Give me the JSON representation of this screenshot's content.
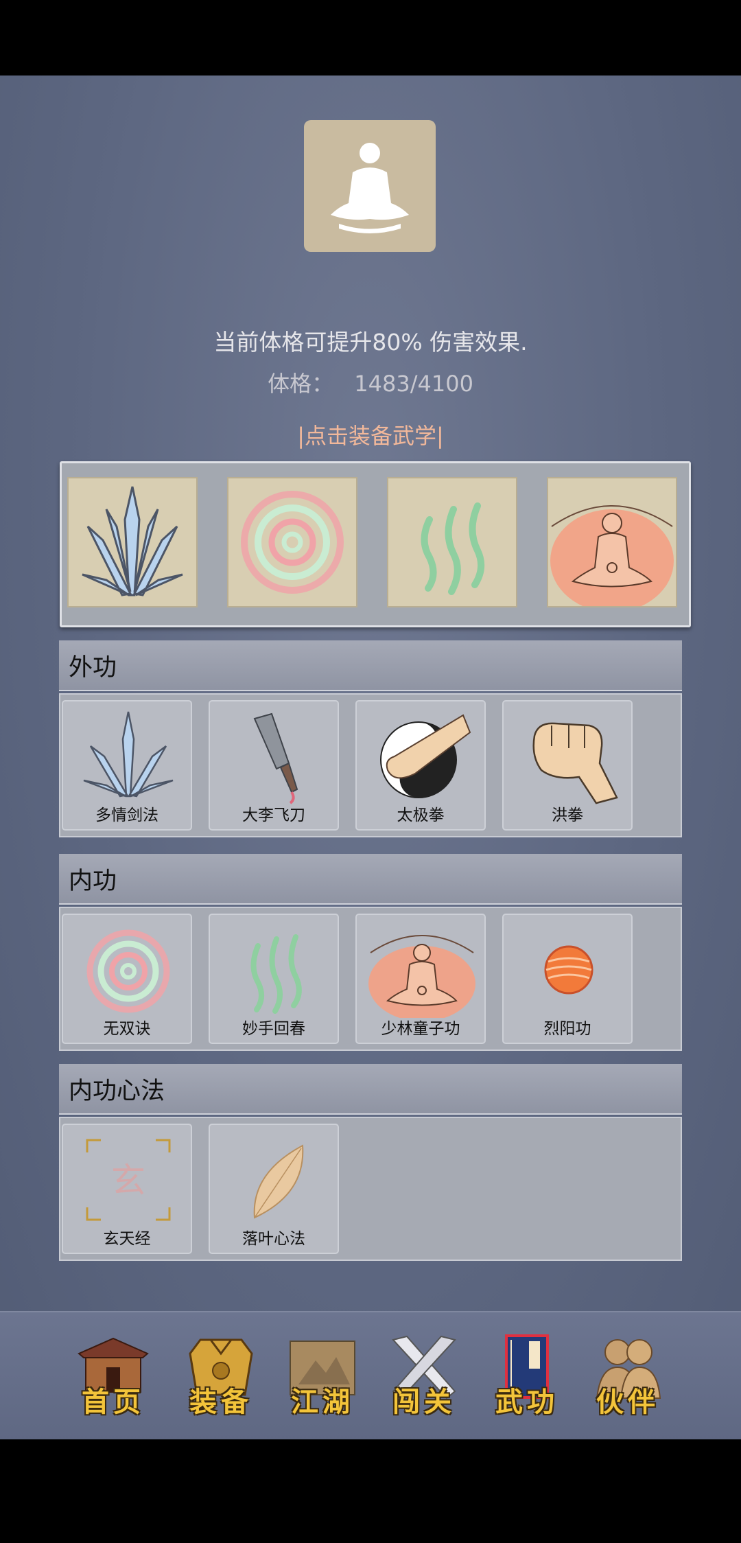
{
  "profile": {
    "description": "当前体格可提升80% 伤害效果.",
    "stat_label": "体格：",
    "stat_value": "1483/4100",
    "equip_prompt": "|点击装备武学|"
  },
  "equipped_slots": [
    {
      "icon": "crystal-blade-icon"
    },
    {
      "icon": "spiral-icon"
    },
    {
      "icon": "green-wave-icon"
    },
    {
      "icon": "meditation-aura-icon"
    }
  ],
  "sections": [
    {
      "title": "外功",
      "skills": [
        {
          "name": "多情剑法",
          "icon": "crystal-blade-icon"
        },
        {
          "name": "大李飞刀",
          "icon": "cleaver-icon"
        },
        {
          "name": "太极拳",
          "icon": "taiji-fist-icon"
        },
        {
          "name": "洪拳",
          "icon": "fist-icon"
        }
      ]
    },
    {
      "title": "内功",
      "skills": [
        {
          "name": "无双诀",
          "icon": "spiral-icon"
        },
        {
          "name": "妙手回春",
          "icon": "green-wave-icon"
        },
        {
          "name": "少林童子功",
          "icon": "meditation-aura-icon"
        },
        {
          "name": "烈阳功",
          "icon": "fire-orb-icon"
        }
      ]
    },
    {
      "title": "内功心法",
      "skills": [
        {
          "name": "玄天经",
          "icon": "xuan-scroll-icon"
        },
        {
          "name": "落叶心法",
          "icon": "leaf-icon"
        }
      ]
    }
  ],
  "xuan_glyph": "玄",
  "nav": [
    {
      "label": "首页",
      "icon": "house-icon"
    },
    {
      "label": "装备",
      "icon": "armor-icon"
    },
    {
      "label": "江湖",
      "icon": "map-scroll-icon"
    },
    {
      "label": "闯关",
      "icon": "crossed-swords-icon"
    },
    {
      "label": "武功",
      "icon": "book-icon"
    },
    {
      "label": "伙伴",
      "icon": "companions-icon"
    }
  ]
}
